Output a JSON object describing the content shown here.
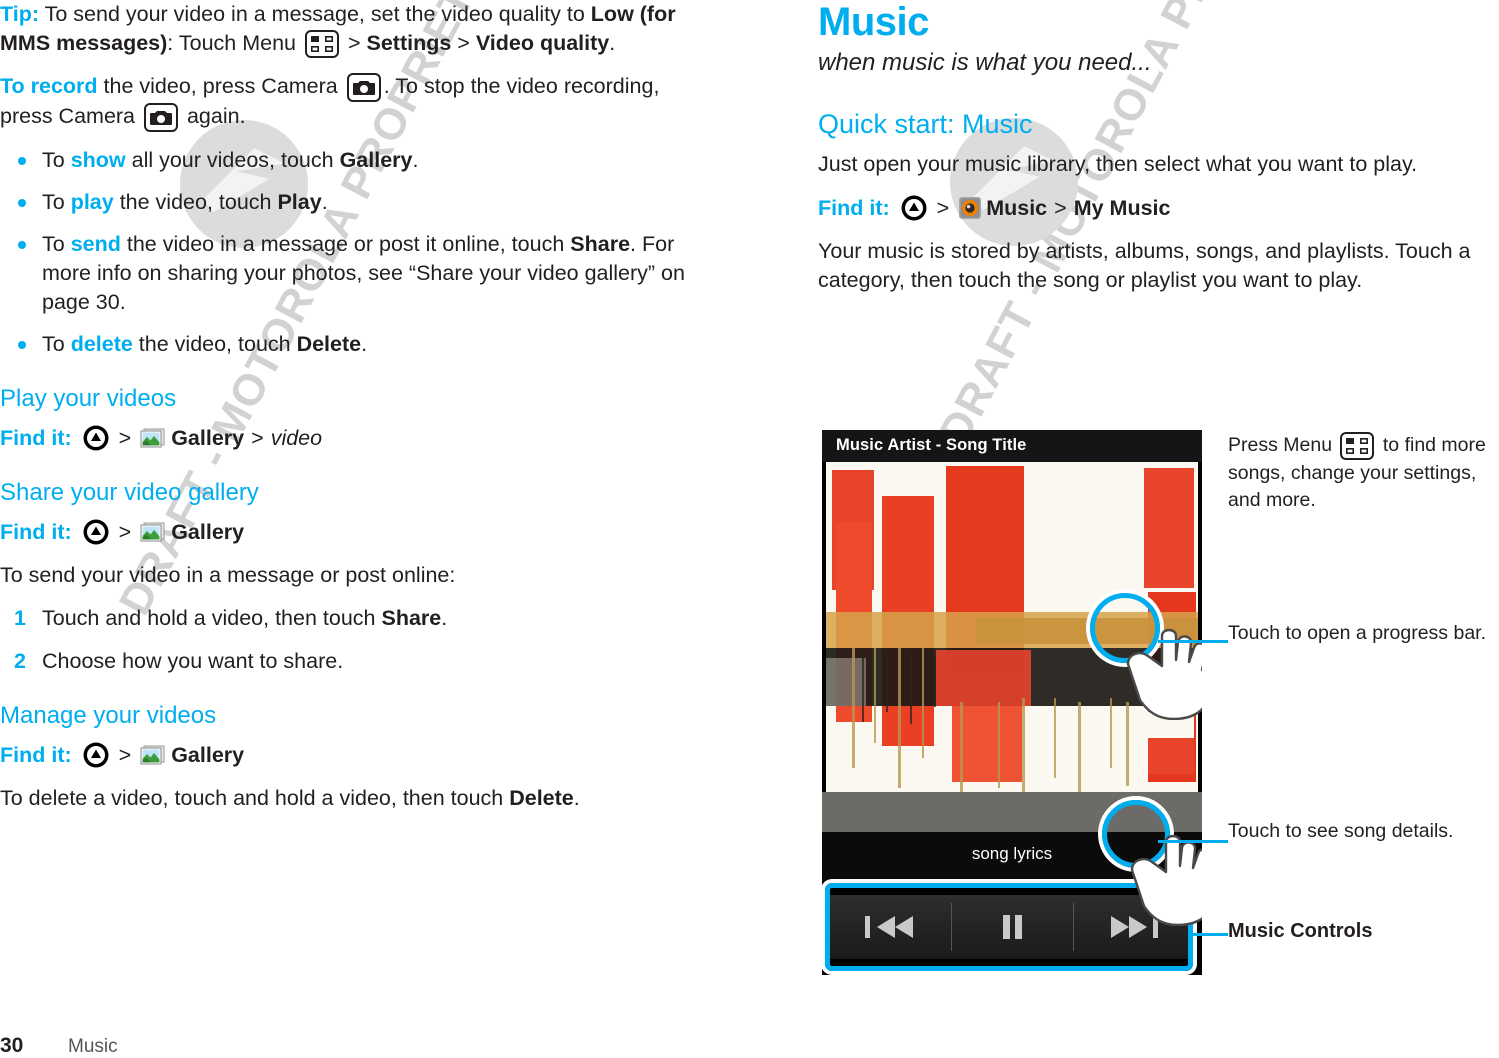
{
  "watermark": {
    "text": "DRAFT - MOTOROLA PROPRIETARY INFORMATION",
    "logo_name": "motorola-batwing-logo"
  },
  "left_column": {
    "tip": {
      "label": "Tip:",
      "part1": " To send your video in a message, set the video quality to ",
      "bold1": "Low (for MMS messages)",
      "part2": ": Touch Menu ",
      "menu_icon": "menu-icon",
      "gt1": " > ",
      "bold2": "Settings",
      "gt2": " > ",
      "bold3": "Video quality",
      "end": "."
    },
    "record": {
      "label": "To record",
      "part1": " the video, press Camera ",
      "camera_icon": "camera-icon",
      "part2": ". To stop the video recording, press Camera ",
      "part3": " again."
    },
    "bullets": [
      {
        "pre": "To ",
        "accent": "show",
        "mid": " all your videos, touch ",
        "bold": "Gallery",
        "post": "."
      },
      {
        "pre": "To ",
        "accent": "play",
        "mid": " the video, touch ",
        "bold": "Play",
        "post": "."
      },
      {
        "pre": "To ",
        "accent": "send",
        "mid": " the video in a message or post it online, touch ",
        "bold": "Share",
        "post": ". For more info on sharing your photos, see “Share your video gallery” on page 30."
      },
      {
        "pre": "To ",
        "accent": "delete",
        "mid": " the video, touch ",
        "bold": "Delete",
        "post": "."
      }
    ],
    "sections": [
      {
        "heading": "Play your videos",
        "findit_label": "Find it:",
        "launcher_icon": "launcher-icon",
        "gallery_icon": "gallery-icon",
        "gallery_label": "Gallery",
        "tail_italic": "video"
      },
      {
        "heading": "Share your video gallery",
        "findit_label": "Find it:",
        "launcher_icon": "launcher-icon",
        "gallery_icon": "gallery-icon",
        "gallery_label": "Gallery"
      },
      {
        "heading": "Manage your videos",
        "findit_label": "Find it:",
        "launcher_icon": "launcher-icon",
        "gallery_icon": "gallery-icon",
        "gallery_label": "Gallery"
      }
    ],
    "share_intro": "To send your video in a message or post online:",
    "steps": [
      {
        "pre": "Touch and hold a video, then touch ",
        "bold": "Share",
        "post": "."
      },
      {
        "pre": "Choose how you want to share.",
        "bold": "",
        "post": ""
      }
    ],
    "delete_para": {
      "pre": "To delete a video, touch and hold a video, then touch ",
      "bold": "Delete",
      "post": "."
    }
  },
  "right_column": {
    "title": "Music",
    "subtitle": "when music is what you need...",
    "quick_start_heading": "Quick start: Music",
    "quick_start_body": "Just open your music library, then select what you want to play.",
    "findit": {
      "label": "Find it:",
      "launcher_icon": "launcher-icon",
      "music_icon": "music-icon",
      "music_label": "Music",
      "gt": ">",
      "my_music_label": "My Music"
    },
    "body": "Your music is stored by artists, albums, songs, and playlists. Touch a category, then touch the song or playlist you want to play."
  },
  "figure": {
    "phone": {
      "title_bar": "Music Artist - Song Title",
      "lyrics_label": "song lyrics",
      "controls": [
        {
          "name": "previous-button",
          "glyph": "skip-back-icon"
        },
        {
          "name": "pause-button",
          "glyph": "pause-icon"
        },
        {
          "name": "next-button",
          "glyph": "skip-forward-icon"
        }
      ]
    },
    "callouts": [
      {
        "id": "menu",
        "pre": "Press Menu ",
        "icon": "menu-icon",
        "post": " to find more songs, change your settings, and more."
      },
      {
        "id": "progress",
        "text": "Touch to open a progress bar."
      },
      {
        "id": "song-details",
        "text": "Touch to see song details."
      },
      {
        "id": "music-controls",
        "text": "Music Controls"
      }
    ]
  },
  "footer": {
    "page_number": "30",
    "chapter": "Music"
  },
  "colors": {
    "accent_blue": "#00aeef",
    "text": "#231f20",
    "watermark_gray": "#d2d2d2"
  }
}
